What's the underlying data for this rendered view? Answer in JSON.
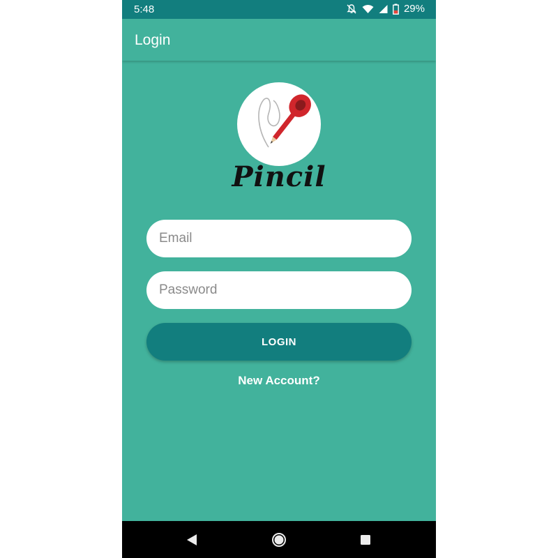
{
  "status_bar": {
    "time": "5:48",
    "battery_percent": "29%",
    "icons": [
      "notifications-off-icon",
      "wifi-icon",
      "cell-signal-icon",
      "battery-low-icon"
    ]
  },
  "app_bar": {
    "title": "Login"
  },
  "logo": {
    "text": "Pincil",
    "icon": "red-pencil-spoon-logo"
  },
  "form": {
    "email_placeholder": "Email",
    "email_value": "",
    "password_placeholder": "Password",
    "password_value": "",
    "login_label": "LOGIN",
    "new_account_label": "New Account?"
  },
  "nav_bar": {
    "buttons": [
      "back-icon",
      "home-icon",
      "recents-icon"
    ]
  },
  "colors": {
    "background": "#42b29c",
    "status_bar": "#127e7e",
    "button": "#127e7e",
    "logo_red": "#d0262c"
  }
}
